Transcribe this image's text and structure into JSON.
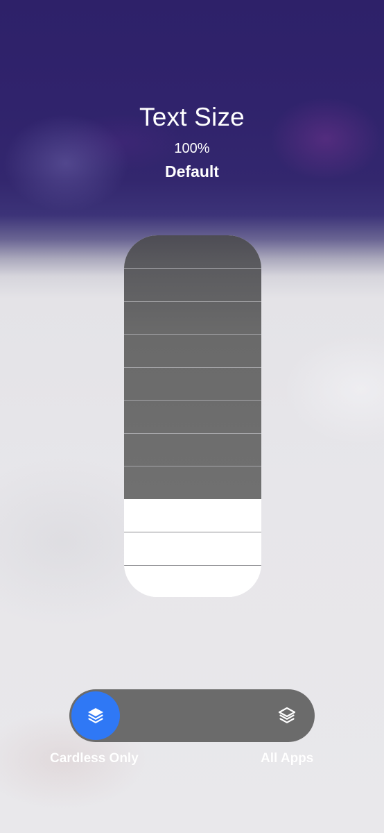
{
  "header": {
    "title": "Text Size",
    "percent": "100%",
    "preset": "Default"
  },
  "text_size_slider": {
    "total_steps": 11,
    "current_step": 3,
    "fill_fraction": 0.273
  },
  "scope_toggle": {
    "options": [
      {
        "label": "Cardless Only",
        "icon": "layers-icon",
        "selected": true
      },
      {
        "label": "All Apps",
        "icon": "layers-icon",
        "selected": false
      }
    ],
    "selected_color": "#2f78f5"
  }
}
